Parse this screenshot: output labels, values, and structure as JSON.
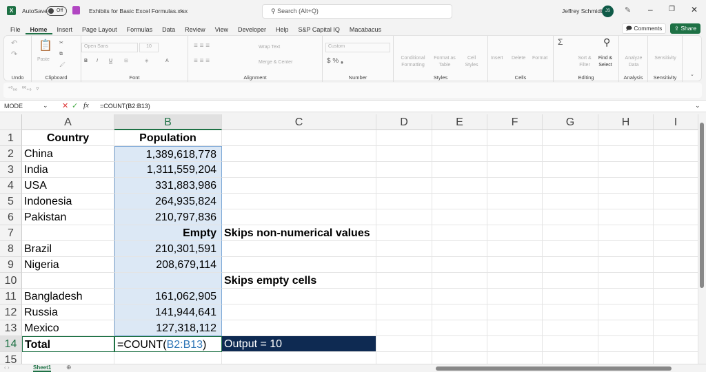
{
  "title_bar": {
    "autosave_label": "AutoSave",
    "autosave_state": "Off",
    "filename": "Exhibits for Basic Excel Formulas.xlsx",
    "search_placeholder": "Search (Alt+Q)",
    "user_name": "Jeffrey Schmidt",
    "user_initials": "JS"
  },
  "menu_tabs": [
    "File",
    "Home",
    "Insert",
    "Page Layout",
    "Formulas",
    "Data",
    "Review",
    "View",
    "Developer",
    "Help",
    "S&P Capital IQ",
    "Macabacus"
  ],
  "active_tab": "Home",
  "comments_label": "Comments",
  "share_label": "Share",
  "ribbon": {
    "groups": [
      "Undo",
      "Clipboard",
      "Font",
      "Alignment",
      "Number",
      "Styles",
      "Cells",
      "Editing",
      "Analysis",
      "Sensitivity"
    ],
    "paste": "Paste",
    "font_name": "Open Sans",
    "font_size": "10",
    "wrap_text": "Wrap Text",
    "merge_center": "Merge & Center",
    "number_format": "Custom",
    "conditional_formatting": "Conditional Formatting",
    "format_as_table": "Format as Table",
    "cell_styles": "Cell Styles",
    "insert": "Insert",
    "delete": "Delete",
    "format": "Format",
    "sort_filter": "Sort & Filter",
    "find_select": "Find & Select",
    "analyze_data": "Analyze Data",
    "sensitivity": "Sensitivity"
  },
  "formula_bar": {
    "name_box": "MODE",
    "formula": "=COUNT(B2:B13)"
  },
  "columns": [
    "A",
    "B",
    "C",
    "D",
    "E",
    "F",
    "G",
    "H",
    "I"
  ],
  "rows": [
    {
      "n": "1",
      "a": "Country",
      "b": "Population",
      "c": ""
    },
    {
      "n": "2",
      "a": "China",
      "b": "1,389,618,778",
      "c": ""
    },
    {
      "n": "3",
      "a": "India",
      "b": "1,311,559,204",
      "c": ""
    },
    {
      "n": "4",
      "a": "USA",
      "b": "331,883,986",
      "c": ""
    },
    {
      "n": "5",
      "a": "Indonesia",
      "b": "264,935,824",
      "c": ""
    },
    {
      "n": "6",
      "a": "Pakistan",
      "b": "210,797,836",
      "c": ""
    },
    {
      "n": "7",
      "a": "",
      "b": "Empty",
      "c": "Skips non-numerical values"
    },
    {
      "n": "8",
      "a": "Brazil",
      "b": "210,301,591",
      "c": ""
    },
    {
      "n": "9",
      "a": "Nigeria",
      "b": "208,679,114",
      "c": ""
    },
    {
      "n": "10",
      "a": "",
      "b": "",
      "c": "Skips empty cells"
    },
    {
      "n": "11",
      "a": "Bangladesh",
      "b": "161,062,905",
      "c": ""
    },
    {
      "n": "12",
      "a": "Russia",
      "b": "141,944,641",
      "c": ""
    },
    {
      "n": "13",
      "a": "Mexico",
      "b": "127,318,112",
      "c": ""
    },
    {
      "n": "14",
      "a": "Total",
      "b_prefix": "=COUNT(",
      "b_ref": "B2:B13",
      "b_suffix": ")",
      "c": "Output = 10"
    },
    {
      "n": "15"
    }
  ],
  "sheet_tab": "Sheet1",
  "colors": {
    "excel_green": "#1e7145",
    "output_bg": "#0e2a52",
    "range_ref": "#2e75b6",
    "selection": "#dce8f5"
  }
}
